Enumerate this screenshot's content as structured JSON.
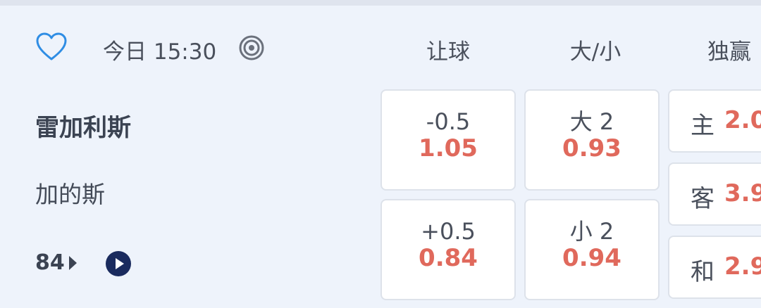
{
  "header": {
    "time": "今日 15:30",
    "col_handicap": "让球",
    "col_over_under": "大/小",
    "col_moneyline": "独赢"
  },
  "teams": {
    "home": "雷加利斯",
    "away": "加的斯"
  },
  "footer": {
    "more_markets_count": "84"
  },
  "handicap": [
    {
      "line": "-0.5",
      "price": "1.05"
    },
    {
      "line": "+0.5",
      "price": "0.84"
    }
  ],
  "over_under": [
    {
      "line": "大 2",
      "price": "0.93"
    },
    {
      "line": "小 2",
      "price": "0.94"
    }
  ],
  "moneyline": [
    {
      "label": "主",
      "price": "2.0"
    },
    {
      "label": "客",
      "price": "3.9"
    },
    {
      "label": "和",
      "price": "2.9"
    }
  ],
  "colors": {
    "accent_blue": "#2f8de4",
    "price_red": "#e0695c",
    "navy": "#1a2b5e"
  },
  "icons": {
    "favorite": "heart-outline-icon",
    "live": "radar-icon",
    "play": "play-circle-icon"
  }
}
